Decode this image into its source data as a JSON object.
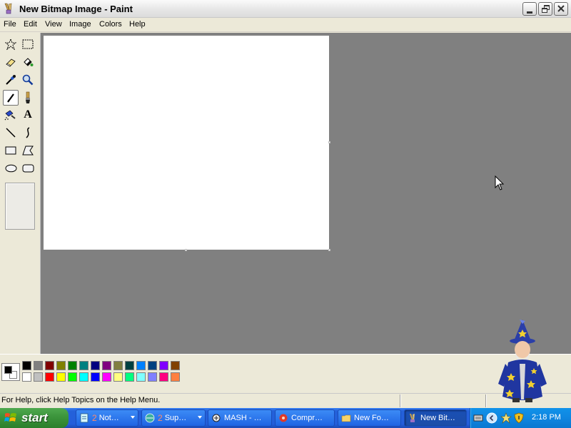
{
  "window": {
    "title": "New Bitmap Image - Paint"
  },
  "menu": [
    "File",
    "Edit",
    "View",
    "Image",
    "Colors",
    "Help"
  ],
  "tools": [
    {
      "name": "free-form-select-icon"
    },
    {
      "name": "select-icon"
    },
    {
      "name": "eraser-icon"
    },
    {
      "name": "fill-with-color-icon"
    },
    {
      "name": "pick-color-icon"
    },
    {
      "name": "magnifier-icon"
    },
    {
      "name": "pencil-icon",
      "selected": true
    },
    {
      "name": "brush-icon"
    },
    {
      "name": "airbrush-icon"
    },
    {
      "name": "text-icon",
      "glyph": "A"
    },
    {
      "name": "line-icon"
    },
    {
      "name": "curve-icon"
    },
    {
      "name": "rectangle-icon"
    },
    {
      "name": "polygon-icon"
    },
    {
      "name": "ellipse-icon"
    },
    {
      "name": "rounded-rectangle-icon"
    }
  ],
  "palette": {
    "primary": "#000000",
    "secondary": "#ffffff",
    "row1": [
      "#000000",
      "#808080",
      "#800000",
      "#808000",
      "#008000",
      "#008080",
      "#000080",
      "#800080",
      "#808040",
      "#004040",
      "#0080ff",
      "#004080",
      "#8000ff",
      "#804000"
    ],
    "row2": [
      "#ffffff",
      "#c0c0c0",
      "#ff0000",
      "#ffff00",
      "#00ff00",
      "#00ffff",
      "#0000ff",
      "#ff00ff",
      "#ffff80",
      "#00ff80",
      "#80ffff",
      "#8080ff",
      "#ff0080",
      "#ff8040"
    ]
  },
  "status": {
    "help": "For Help, click Help Topics on the Help Menu."
  },
  "taskbar": {
    "start_label": "start",
    "items": [
      {
        "count": "2",
        "label": "Not…",
        "icon": "notepad-icon",
        "grouped": true
      },
      {
        "count": "2",
        "label": "Sup…",
        "icon": "browser-icon",
        "grouped": true
      },
      {
        "label": "MASH - …",
        "icon": "agent-icon"
      },
      {
        "label": "Compr…",
        "icon": "compress-icon"
      },
      {
        "label": "New Fo…",
        "icon": "folder-icon"
      },
      {
        "label": "New Bit…",
        "icon": "paint-icon",
        "active": true
      }
    ],
    "clock": "2:18 PM"
  }
}
